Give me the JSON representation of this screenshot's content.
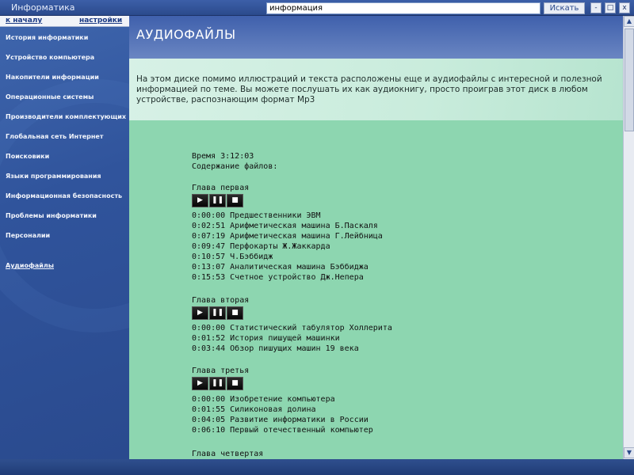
{
  "window": {
    "title": "Информатика",
    "min": "-",
    "max": "□",
    "close": "x"
  },
  "search": {
    "value": "информация",
    "button": "Искать"
  },
  "nav": {
    "home": "к началу",
    "settings": "настройки"
  },
  "sidebar": {
    "items": [
      "История информатики",
      "Устройство компьютера",
      "Накопители информации",
      "Операционные системы",
      "Производители комплектующих",
      "Глобальная сеть Интернет",
      "Поисковики",
      "Языки программирования",
      "Информационная безопасность",
      "Проблемы информатики",
      "Персоналии"
    ],
    "audio_link": "Аудиофайлы"
  },
  "main": {
    "title": "АУДИОФАЙЛЫ",
    "intro": "На этом диске помимо иллюстраций и текста расположены еще и аудиофайлы с интересной и полезной информацией по теме. Вы можете послушать их как аудиокнигу, просто проиграв этот диск в любом устройстве, распознающим формат Mp3",
    "time": "Время 3:12:03",
    "contents_label": "Содержание файлов:",
    "player": {
      "play": "▶",
      "pause": "❚❚",
      "stop": "■"
    },
    "sections": [
      {
        "title": "Глава первая",
        "tracks": [
          "0:00:00 Предшественники ЭВМ",
          "0:02:51 Арифметическая машина Б.Паскаля",
          "0:07:19 Арифметическая машина Г.Лейбница",
          "0:09:47 Перфокарты Ж.Жаккарда",
          "0:10:57 Ч.Бэббидж",
          "0:13:07 Аналитическая машина Бэббиджа",
          "0:15:53 Счетное устройство Дж.Непера"
        ]
      },
      {
        "title": "Глава вторая",
        "tracks": [
          "0:00:00 Статистический табулятор Холлерита",
          "0:01:52 История пишущей машинки",
          "0:03:44 Обзор пишущих машин 19 века"
        ]
      },
      {
        "title": "Глава третья",
        "tracks": [
          "0:00:00 Изобретение компьютера",
          "0:01:55 Силиконовая долина",
          "0:04:05 Развитие информатики в России",
          "0:06:10 Первый отечественный компьютер"
        ]
      },
      {
        "title": "Глава четвертая",
        "tracks": []
      }
    ]
  },
  "scrollbar": {
    "up": "▲",
    "down": "▼"
  },
  "colors": {
    "sidebar": "#2e4a8a",
    "content_bg": "#8dd6b0",
    "header": "#3f60ac",
    "intro_bg": "#d7f1e6"
  }
}
